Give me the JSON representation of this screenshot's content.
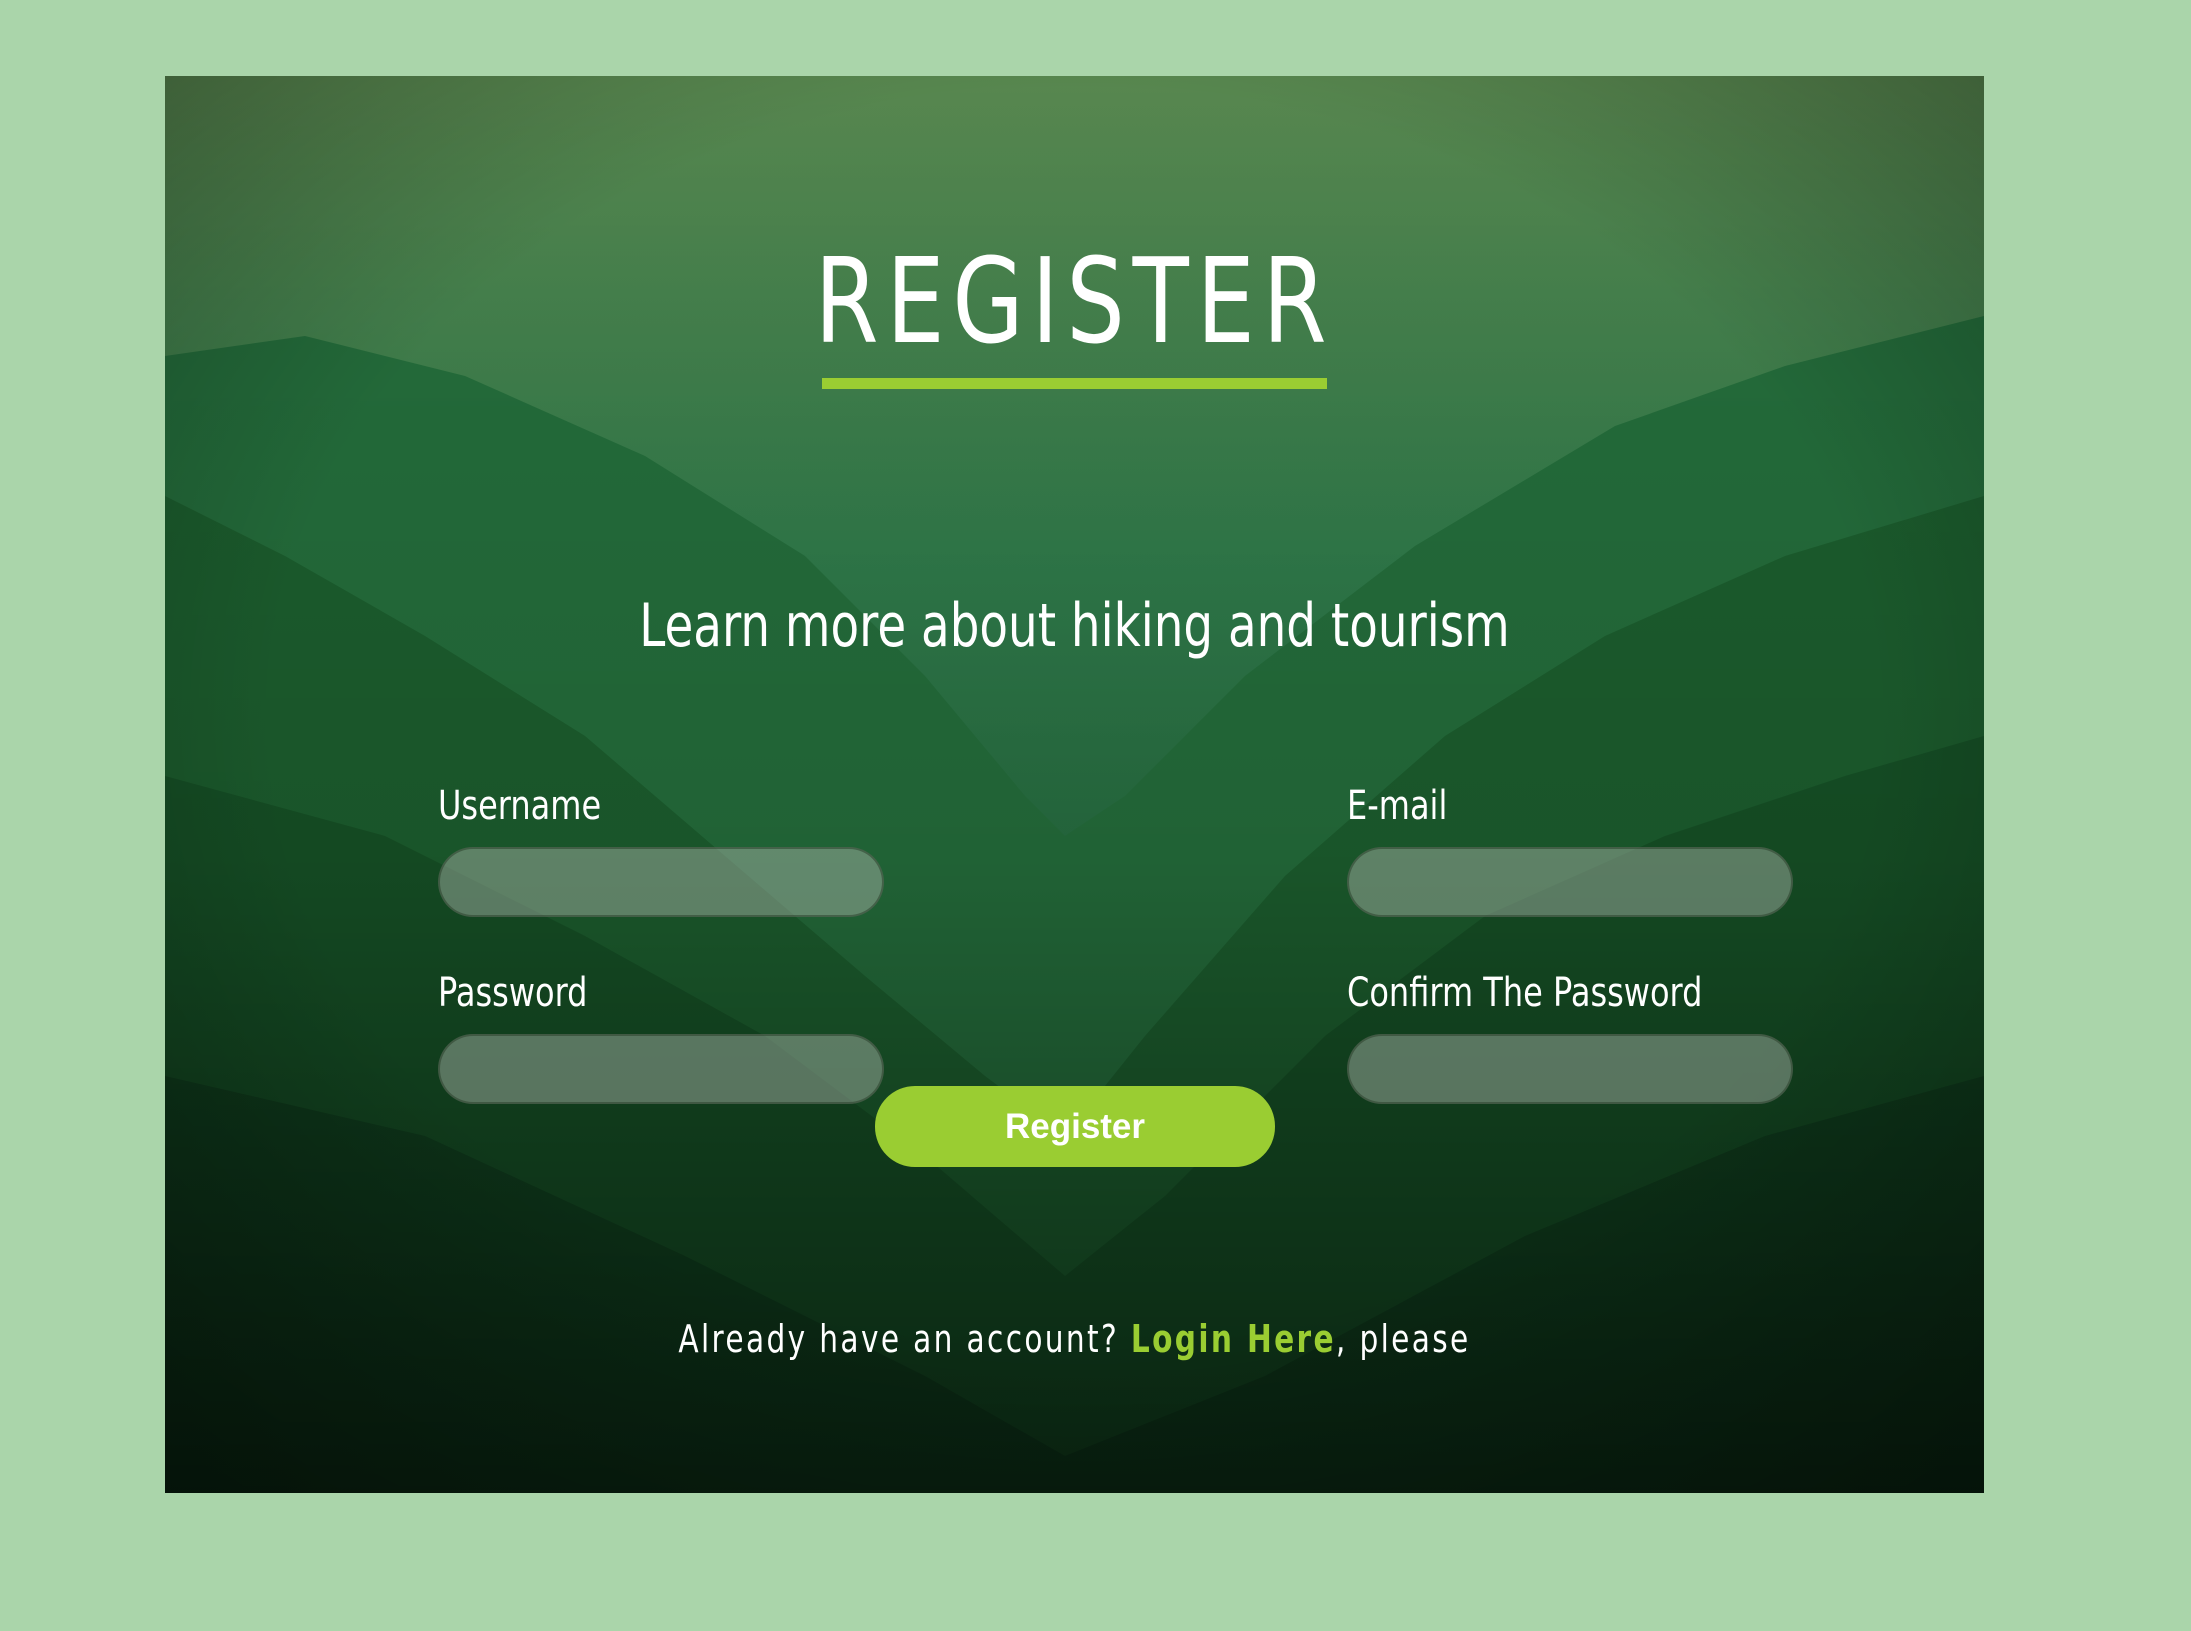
{
  "header": {
    "title": "REGISTER",
    "subtitle": "Learn more about hiking and tourism"
  },
  "form": {
    "username": {
      "label": "Username",
      "value": "",
      "placeholder": ""
    },
    "email": {
      "label": "E-mail",
      "value": "",
      "placeholder": ""
    },
    "password": {
      "label": "Password",
      "value": "",
      "placeholder": ""
    },
    "confirm_password": {
      "label": "Confirm The Password",
      "value": "",
      "placeholder": ""
    },
    "submit_label": "Register"
  },
  "footer": {
    "prefix": "Already have an account? ",
    "link_text": "Login Here",
    "suffix": ", please"
  },
  "colors": {
    "page_background": "#aad5aa",
    "accent": "#9acd32",
    "text": "#ffffff"
  }
}
